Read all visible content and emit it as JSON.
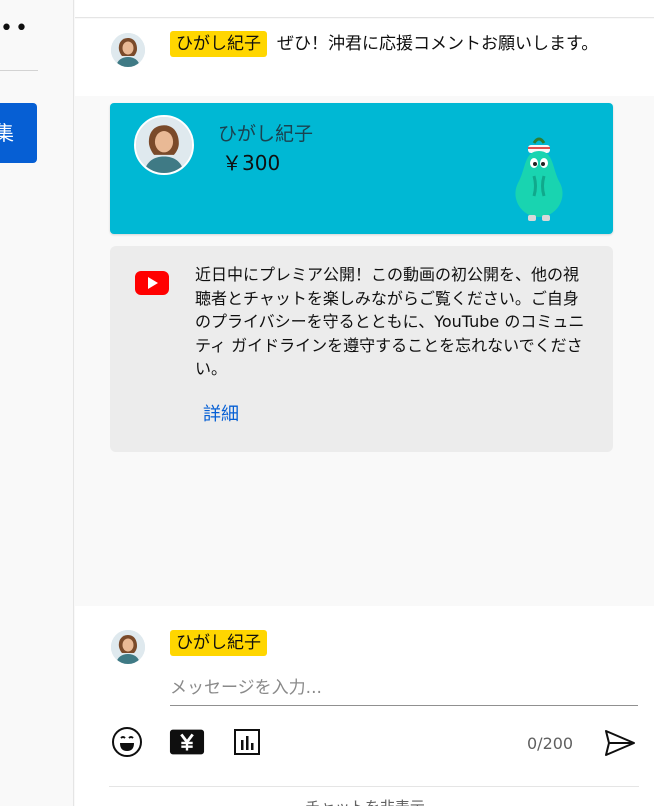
{
  "left": {
    "more_label": "⋮",
    "edit_label": "集"
  },
  "message": {
    "author": "ひがし紀子",
    "text": "ぜひ！沖君に応援コメントお願いします。"
  },
  "superchat": {
    "author": "ひがし紀子",
    "amount": "￥300",
    "color": "#00b8d4"
  },
  "notice": {
    "text": "近日中にプレミア公開！この動画の初公開を、他の視聴者とチャットを楽しみながらご覧ください。ご自身のプライバシーを守るとともに、YouTube のコミュニティ ガイドラインを遵守することを忘れないでください。",
    "learn_more": "詳細"
  },
  "input": {
    "author": "ひがし紀子",
    "placeholder": "メッセージを入力...",
    "counter": "0/200",
    "icons": [
      "emoji-icon",
      "yen-icon",
      "poll-icon",
      "send-icon"
    ]
  },
  "footer": {
    "hide_chat": "チャットを非表示"
  },
  "colors": {
    "author_chip": "#ffd600",
    "link": "#065fd4",
    "youtube_red": "#ff0000"
  }
}
